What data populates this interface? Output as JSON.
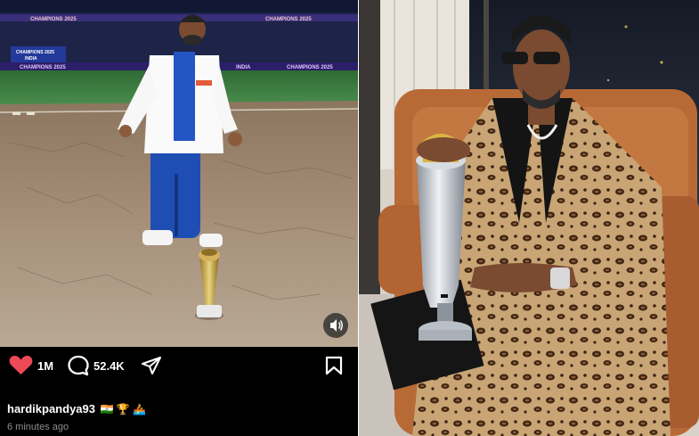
{
  "post": {
    "likes": "1M",
    "comments": "52.4K",
    "username": "hardikpandya93",
    "badges": "🇮🇳 🏆 🚣",
    "time": "6 minutes ago"
  },
  "stadium": {
    "board_top": "CHAMPIONS 2025",
    "board_screen": "CHAMPIONS 2025 INDIA",
    "board_ad": "INDIA"
  },
  "colors": {
    "like_red": "#ed4956",
    "pitch_brown": "#a38a70",
    "grass_green": "#3f7c41",
    "jersey_blue": "#1e4eb4"
  }
}
